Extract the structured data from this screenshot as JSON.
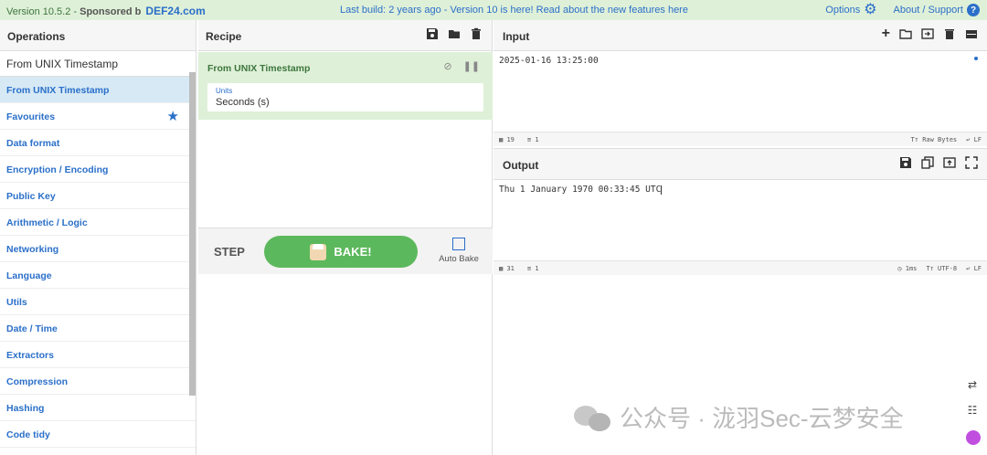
{
  "banner": {
    "version": "Version 10.5.2 - ",
    "sponsored": "Sponsored b",
    "sponsor_name": "DEF24.com",
    "notice": "Last build: 2 years ago - Version 10 is here! Read about the new features here",
    "options_label": "Options",
    "about_label": "About / Support"
  },
  "operations": {
    "title": "Operations",
    "search_value": "From UNIX Timestamp",
    "items": [
      {
        "label": "From UNIX Timestamp",
        "selected": true
      },
      {
        "label": "Favourites",
        "icon": "star-icon"
      },
      {
        "label": "Data format"
      },
      {
        "label": "Encryption / Encoding"
      },
      {
        "label": "Public Key"
      },
      {
        "label": "Arithmetic / Logic"
      },
      {
        "label": "Networking"
      },
      {
        "label": "Language"
      },
      {
        "label": "Utils"
      },
      {
        "label": "Date / Time"
      },
      {
        "label": "Extractors"
      },
      {
        "label": "Compression"
      },
      {
        "label": "Hashing"
      },
      {
        "label": "Code tidy"
      }
    ]
  },
  "recipe": {
    "title": "Recipe",
    "operation": {
      "name": "From UNIX Timestamp",
      "field_label": "Units",
      "field_value": "Seconds (s)"
    },
    "step_label": "STEP",
    "bake_label": "BAKE!",
    "autobake_label": "Auto Bake"
  },
  "input": {
    "title": "Input",
    "text": "2025-01-16 13:25:00",
    "char_count": "19",
    "line_count": "1",
    "encoding": "Raw Bytes",
    "eol": "LF"
  },
  "output": {
    "title": "Output",
    "text": "Thu 1 January 1970 00:33:45 UTC",
    "char_count": "31",
    "line_count": "1",
    "time": "1ms",
    "encoding": "UTF-8",
    "eol": "LF"
  },
  "watermark": {
    "text": "公众号 · 泷羽Sec-云梦安全"
  },
  "colors": {
    "accent": "#2a6fc9",
    "bake": "#5cb85c",
    "recipe_bg": "#dff0d8"
  }
}
